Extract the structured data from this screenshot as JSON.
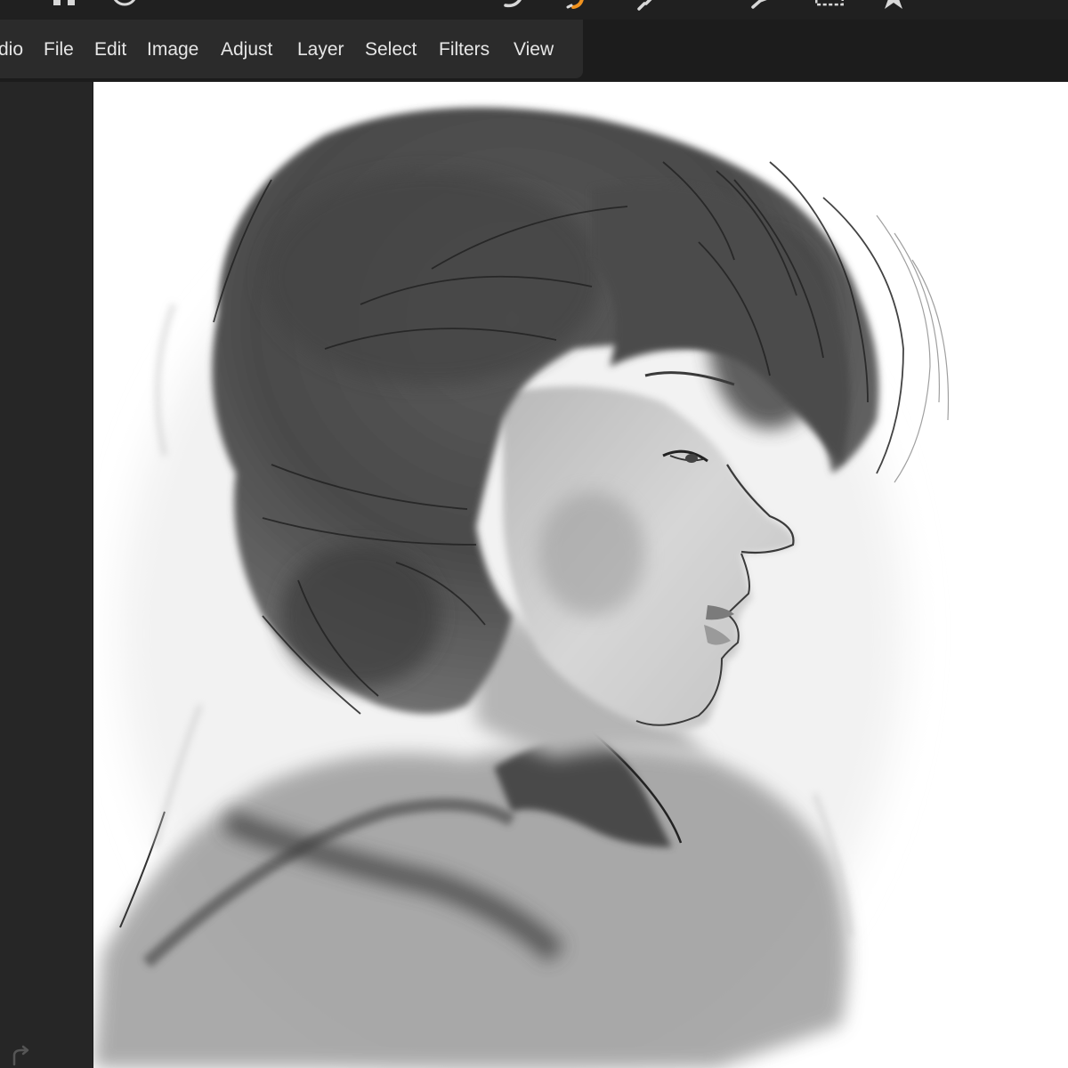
{
  "menubar": {
    "items": [
      {
        "label": "dio"
      },
      {
        "label": "File"
      },
      {
        "label": "Edit"
      },
      {
        "label": "Image"
      },
      {
        "label": "Adjust"
      },
      {
        "label": "Layer"
      },
      {
        "label": "Select"
      },
      {
        "label": "Filters"
      },
      {
        "label": "View"
      }
    ]
  },
  "toolbar": {
    "icons": [
      "home-icon",
      "history-icon",
      "smudge-brush-icon",
      "dodge-burn-icon",
      "eraser-icon",
      "eyedropper-icon",
      "marquee-select-icon",
      "favorites-star-icon"
    ]
  },
  "leftstrip": {
    "icons": [
      "redo-icon"
    ]
  },
  "canvas": {
    "artwork": "grayscale-portrait-painting"
  },
  "colors": {
    "chrome_dark": "#1c1c1c",
    "menubar_bg": "#2b2b2b",
    "menu_text": "#e6e6e6",
    "canvas_bg": "#ffffff",
    "accent_orange": "#f0921e"
  }
}
